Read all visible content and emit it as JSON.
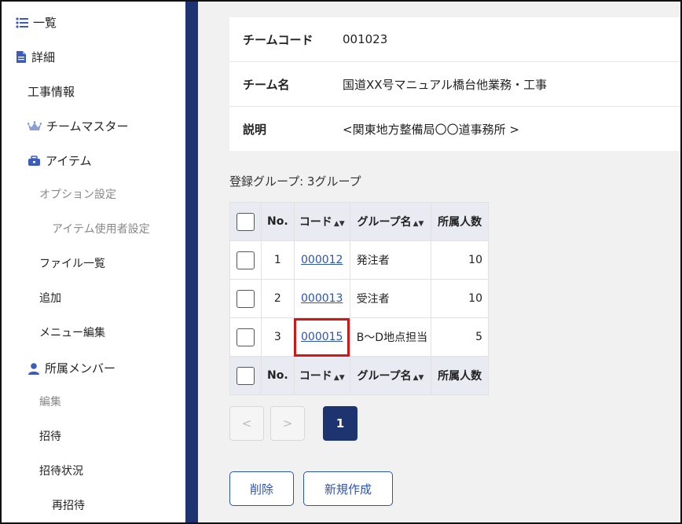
{
  "sidebar": {
    "list_label": "一覧",
    "detail_label": "詳細",
    "construction_info": "工事情報",
    "team_master": "チームマスター",
    "item": "アイテム",
    "option_settings": "オプション設定",
    "item_user_settings": "アイテム使用者設定",
    "file_list": "ファイル一覧",
    "add": "追加",
    "menu_edit": "メニュー編集",
    "members": "所属メンバー",
    "edit": "編集",
    "invite": "招待",
    "invite_status": "招待状況",
    "reinvite": "再招待"
  },
  "team": {
    "code_label": "チームコード",
    "code_value": "001023",
    "name_label": "チーム名",
    "name_value": "国道XX号マニュアル橋台他業務・工事",
    "desc_label": "説明",
    "desc_value": "<関東地方整備局〇〇道事務所 >"
  },
  "groups": {
    "summary": "登録グループ: 3グループ",
    "headers": {
      "no": "No.",
      "code": "コード",
      "name": "グループ名",
      "count": "所属人数",
      "sort_glyph": "▲▼"
    },
    "rows": [
      {
        "no": "1",
        "code": "000012",
        "name": "発注者",
        "count": "10"
      },
      {
        "no": "2",
        "code": "000013",
        "name": "受注者",
        "count": "10"
      },
      {
        "no": "3",
        "code": "000015",
        "name": "B〜D地点担当",
        "count": "5"
      }
    ]
  },
  "pagination": {
    "prev": "<",
    "next": ">",
    "current": "1"
  },
  "actions": {
    "delete": "削除",
    "create": "新規作成"
  },
  "colors": {
    "navy": "#1e3470",
    "link": "#2b54b8",
    "highlight": "#d01818"
  }
}
